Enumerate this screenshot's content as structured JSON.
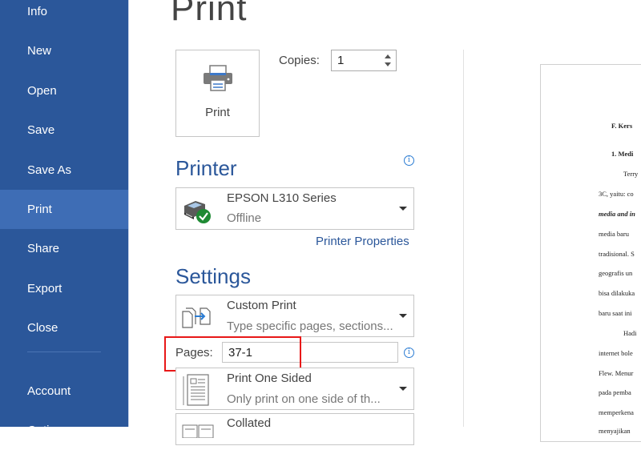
{
  "sidebar": {
    "items": [
      {
        "label": "Info"
      },
      {
        "label": "New"
      },
      {
        "label": "Open"
      },
      {
        "label": "Save"
      },
      {
        "label": "Save As"
      },
      {
        "label": "Print",
        "active": true
      },
      {
        "label": "Share"
      },
      {
        "label": "Export"
      },
      {
        "label": "Close"
      },
      {
        "label": "Account"
      },
      {
        "label": "Options"
      }
    ],
    "colors": {
      "background": "#2b579a",
      "active": "#3e6db5"
    }
  },
  "page": {
    "title": "Print"
  },
  "print_button": {
    "label": "Print",
    "icon": "printer-icon"
  },
  "copies": {
    "label": "Copies:",
    "value": "1"
  },
  "printer": {
    "section_title": "Printer",
    "name": "EPSON L310 Series",
    "status": "Offline",
    "icon": "printer-ready-icon",
    "properties_link": "Printer Properties"
  },
  "settings": {
    "section_title": "Settings",
    "print_range": {
      "title": "Custom Print",
      "subtitle": "Type specific pages, sections...",
      "icon": "custom-print-icon"
    },
    "pages": {
      "label": "Pages:",
      "value": "37-1"
    },
    "sides": {
      "title": "Print One Sided",
      "subtitle": "Only print on one side of th...",
      "icon": "one-sided-icon"
    },
    "collation": {
      "title": "Collated",
      "icon": "collated-icon"
    }
  },
  "preview": {
    "lines": [
      {
        "text": "F.  Kers",
        "style": "b"
      },
      {
        "text": "1.  Medi",
        "style": "b"
      },
      {
        "text": "Terry",
        "style": ""
      },
      {
        "text": "3C, yaitu: co",
        "style": ""
      },
      {
        "text": "media and in",
        "style": "i"
      },
      {
        "text": "media  baru",
        "style": ""
      },
      {
        "text": "tradisional. S",
        "style": ""
      },
      {
        "text": "geografis un",
        "style": ""
      },
      {
        "text": "bisa dilakuka",
        "style": ""
      },
      {
        "text": "baru saat ini",
        "style": ""
      },
      {
        "text": "Hadi",
        "style": ""
      },
      {
        "text": "internet bole",
        "style": ""
      },
      {
        "text": "Flew. Menur",
        "style": ""
      },
      {
        "text": "pada  pemba",
        "style": ""
      },
      {
        "text": "memperkena",
        "style": ""
      },
      {
        "text": "menyajikan",
        "style": ""
      }
    ]
  }
}
